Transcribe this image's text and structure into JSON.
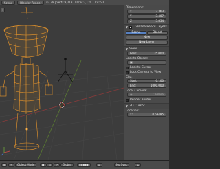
{
  "infobar": {
    "menu": "Scene",
    "engine": "Blender Render",
    "stats": "v2.79 | Verts:3,218 | Faces:3,120 | Tris:6,2..."
  },
  "npanel": {
    "dimensions_label": "Dimensions:",
    "dimensions": [
      {
        "axis": "X",
        "value": "3.363"
      },
      {
        "axis": "Y",
        "value": "3.407"
      },
      {
        "axis": "Z",
        "value": "3.834"
      }
    ],
    "grease_pencil_label": "Grease Pencil Layers",
    "scene_tab": "Scene",
    "object_tab": "Object",
    "new_button": "New",
    "new_layer_button": "New Layer",
    "view_label": "View",
    "lens_label": "Lens:",
    "lens_value": "35.000",
    "lock_to_object_label": "Lock to Object:",
    "lock_to_cursor_label": "Lock to Cursor",
    "lock_camera_label": "Lock Camera to View",
    "clip_label": "Clip:",
    "clip_start_label": "Start:",
    "clip_start_value": "0.100",
    "clip_end_label": "End:",
    "clip_end_value": "1000.000",
    "local_camera_label": "Local Camera:",
    "camera_field": "Camera",
    "render_border_label": "Render Border",
    "cursor_label": "3D Cursor",
    "location_label": "Location:",
    "location_x_label": "X:",
    "location_x_value": "0.53485"
  },
  "footer": {
    "mode": "Object Mode",
    "orientation": "Global",
    "sync": "No Sync"
  },
  "colors": {
    "wire": "#f09a2b",
    "selected": "#ffb347",
    "grid": "#4a4a4a",
    "active_tab": "#5680c2"
  }
}
